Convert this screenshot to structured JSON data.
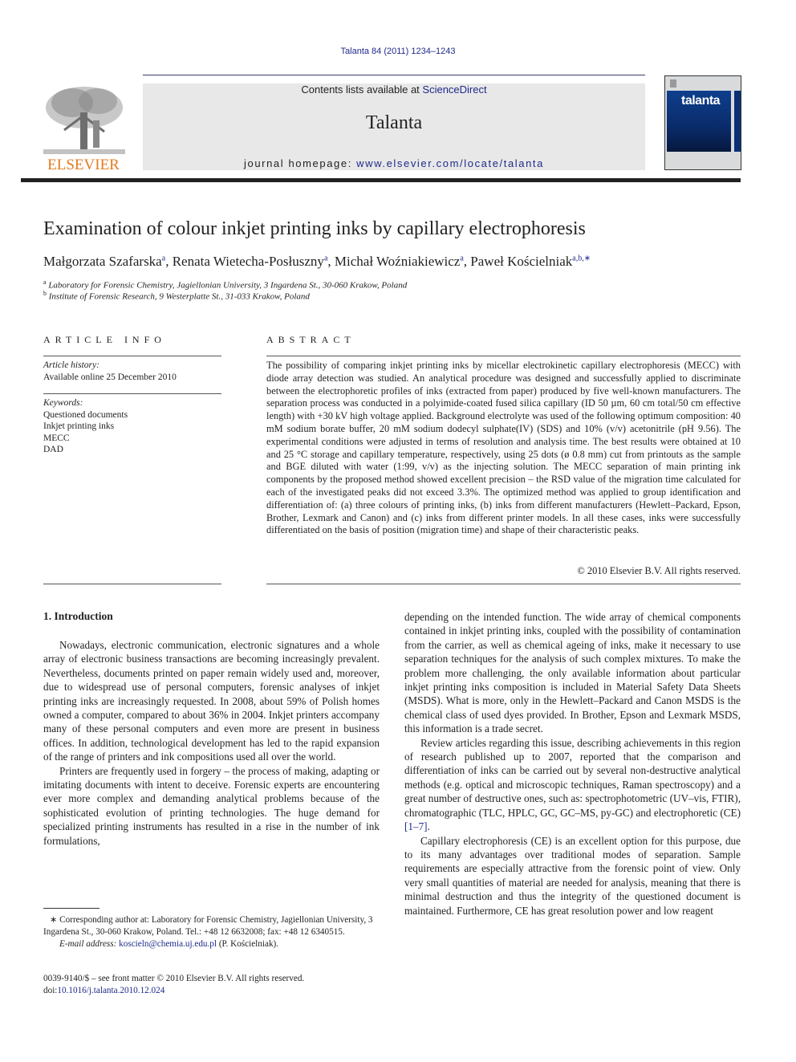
{
  "header": {
    "citation": "Talanta 84 (2011) 1234–1243",
    "publisher_logo_text": "ELSEVIER",
    "contents_prefix": "Contents lists available at ",
    "contents_link": "ScienceDirect",
    "journal_name": "Talanta",
    "homepage_prefix": "journal homepage: ",
    "homepage_link": "www.elsevier.com/locate/talanta",
    "cover_title": "talanta"
  },
  "article": {
    "title": "Examination of colour inkjet printing inks by capillary electrophoresis",
    "authors": [
      {
        "name": "Małgorzata Szafarska",
        "sup": "a"
      },
      {
        "name": "Renata Wietecha-Posłuszny",
        "sup": "a"
      },
      {
        "name": "Michał Woźniakiewicz",
        "sup": "a"
      },
      {
        "name": "Paweł Kościelniak",
        "sup": "a,b,∗"
      }
    ],
    "affiliations": [
      {
        "mark": "a",
        "text": "Laboratory for Forensic Chemistry, Jagiellonian University, 3 Ingardena St., 30-060 Krakow, Poland"
      },
      {
        "mark": "b",
        "text": "Institute of Forensic Research, 9 Westerplatte St., 31-033 Krakow, Poland"
      }
    ]
  },
  "article_info": {
    "heading": "ARTICLE INFO",
    "history_label": "Article history:",
    "history_value": "Available online 25 December 2010",
    "keywords_label": "Keywords:",
    "keywords": [
      "Questioned documents",
      "Inkjet printing inks",
      "MECC",
      "DAD"
    ]
  },
  "abstract": {
    "heading": "ABSTRACT",
    "text": "The possibility of comparing inkjet printing inks by micellar electrokinetic capillary electrophoresis (MECC) with diode array detection was studied. An analytical procedure was designed and successfully applied to discriminate between the electrophoretic profiles of inks (extracted from paper) produced by five well-known manufacturers. The separation process was conducted in a polyimide-coated fused silica capillary (ID 50 µm, 60 cm total/50 cm effective length) with +30 kV high voltage applied. Background electrolyte was used of the following optimum composition: 40 mM sodium borate buffer, 20 mM sodium dodecyl sulphate(IV) (SDS) and 10% (v/v) acetonitrile (pH 9.56). The experimental conditions were adjusted in terms of resolution and analysis time. The best results were obtained at 10 and 25 °C storage and capillary temperature, respectively, using 25 dots (ø 0.8 mm) cut from printouts as the sample and BGE diluted with water (1:99, v/v) as the injecting solution. The MECC separation of main printing ink components by the proposed method showed excellent precision – the RSD value of the migration time calculated for each of the investigated peaks did not exceed 3.3%. The optimized method was applied to group identification and differentiation of: (a) three colours of printing inks, (b) inks from different manufacturers (Hewlett–Packard, Epson, Brother, Lexmark and Canon) and (c) inks from different printer models. In all these cases, inks were successfully differentiated on the basis of position (migration time) and shape of their characteristic peaks.",
    "copyright": "© 2010 Elsevier B.V. All rights reserved."
  },
  "body": {
    "section_heading": "1.  Introduction",
    "left_paragraphs": [
      "Nowadays, electronic communication, electronic signatures and a whole array of electronic business transactions are becoming increasingly prevalent. Nevertheless, documents printed on paper remain widely used and, moreover, due to widespread use of personal computers, forensic analyses of inkjet printing inks are increasingly requested. In 2008, about 59% of Polish homes owned a computer, compared to about 36% in 2004. Inkjet printers accompany many of these personal computers and even more are present in business offices. In addition, technological development has led to the rapid expansion of the range of printers and ink compositions used all over the world.",
      "Printers are frequently used in forgery – the process of making, adapting or imitating documents with intent to deceive. Forensic experts are encountering ever more complex and demanding analytical problems because of the sophisticated evolution of printing technologies. The huge demand for specialized printing instruments has resulted in a rise in the number of ink formulations,"
    ],
    "right_paragraph_1": "depending on the intended function. The wide array of chemical components contained in inkjet printing inks, coupled with the possibility of contamination from the carrier, as well as chemical ageing of inks, make it necessary to use separation techniques for the analysis of such complex mixtures. To make the problem more challenging, the only available information about particular inkjet printing inks composition is included in Material Safety Data Sheets (MSDS). What is more, only in the Hewlett–Packard and Canon MSDS is the chemical class of used dyes provided. In Brother, Epson and Lexmark MSDS, this information is a trade secret.",
    "right_paragraph_2_text": "Review articles regarding this issue, describing achievements in this region of research published up to 2007, reported that the comparison and differentiation of inks can be carried out by several non-destructive analytical methods (e.g. optical and microscopic techniques, Raman spectroscopy) and a great number of destructive ones, such as: spectrophotometric (UV–vis, FTIR), chromatographic (TLC, HPLC, GC, GC–MS, py-GC) and electrophoretic (CE) ",
    "right_paragraph_2_ref": "[1–7]",
    "right_paragraph_2_end": ".",
    "right_paragraph_3": "Capillary electrophoresis (CE) is an excellent option for this purpose, due to its many advantages over traditional modes of separation. Sample requirements are especially attractive from the forensic point of view. Only very small quantities of material are needed for analysis, meaning that there is minimal destruction and thus the integrity of the questioned document is maintained. Furthermore, CE has great resolution power and low reagent"
  },
  "footnote": {
    "corresponding": "∗  Corresponding author at: Laboratory for Forensic Chemistry, Jagiellonian University, 3 Ingardena St., 30-060 Krakow, Poland. Tel.: +48 12 6632008; fax: +48 12 6340515.",
    "email_label": "E-mail address: ",
    "email": "koscieln@chemia.uj.edu.pl",
    "email_suffix": " (P. Kościelniak).",
    "issn_line": "0039-9140/$ – see front matter © 2010 Elsevier B.V. All rights reserved.",
    "doi_prefix": "doi:",
    "doi": "10.1016/j.talanta.2010.12.024"
  },
  "colors": {
    "link": "#1f2a8a",
    "elsevier_orange": "#e57a1e",
    "banner_bg": "#e8e8e8"
  }
}
